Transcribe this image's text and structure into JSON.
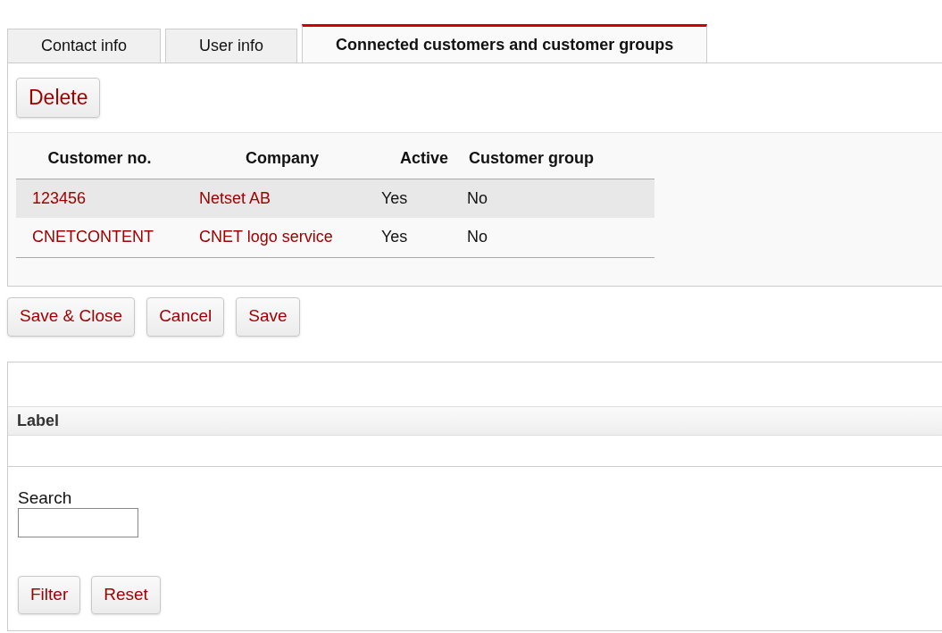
{
  "tabs": [
    {
      "label": "Contact info",
      "selected": false
    },
    {
      "label": "User info",
      "selected": false
    },
    {
      "label": "Connected customers and customer groups",
      "selected": true
    }
  ],
  "delete_button": "Delete",
  "table": {
    "columns": [
      "Customer no.",
      "Company",
      "Active",
      "Customer group"
    ],
    "rows": [
      {
        "customer_no": "123456",
        "company": "Netset AB",
        "active": "Yes",
        "customer_group": "No",
        "selected": true
      },
      {
        "customer_no": "CNETCONTENT",
        "company": "CNET logo service",
        "active": "Yes",
        "customer_group": "No",
        "selected": false
      }
    ]
  },
  "actions": [
    "Save & Close",
    "Cancel",
    "Save"
  ],
  "filter_panel": {
    "header": "Label",
    "search_label": "Search",
    "buttons": [
      "Filter",
      "Reset"
    ]
  }
}
